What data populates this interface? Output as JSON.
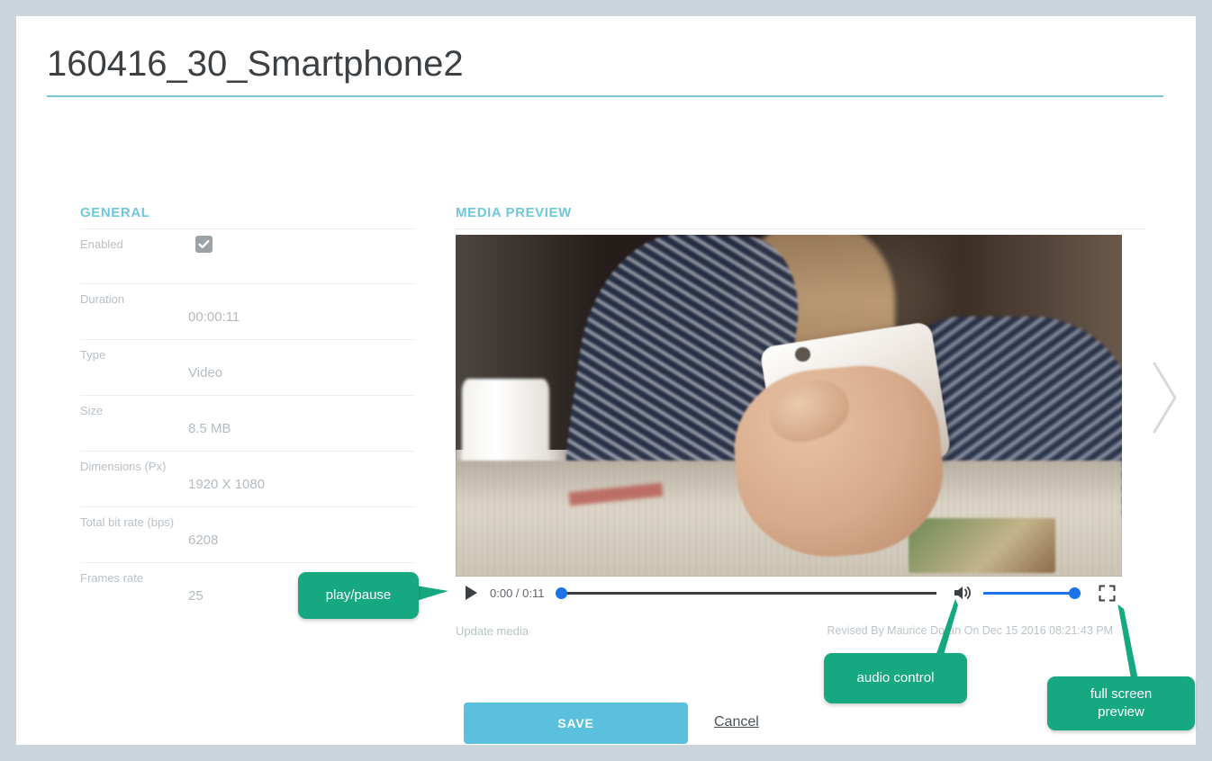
{
  "page": {
    "title": "160416_30_Smartphone2",
    "accent_underline": "#7cc4d0",
    "background": "#ccd4dc",
    "card_background": "#ffffff"
  },
  "general": {
    "heading": "GENERAL",
    "heading_color": "#6fc7dc",
    "fields": [
      {
        "label": "Enabled",
        "value": "",
        "type": "checkbox",
        "checked": true
      },
      {
        "label": "Duration",
        "value": "00:00:11",
        "type": "text"
      },
      {
        "label": "Type",
        "value": "Video",
        "type": "text"
      },
      {
        "label": "Size",
        "value": "8.5 MB",
        "type": "text"
      },
      {
        "label": "Dimensions (Px)",
        "value": "1920 X 1080",
        "type": "text"
      },
      {
        "label": "Total bit rate (bps)",
        "value": "6208",
        "type": "text"
      },
      {
        "label": "Frames rate",
        "value": "25",
        "type": "text"
      }
    ]
  },
  "media_preview": {
    "heading": "MEDIA PREVIEW",
    "player": {
      "play_icon": "play-icon",
      "time_display": "0:00 / 0:11",
      "current_time": "0:00",
      "duration": "0:11",
      "progress_percent": 0,
      "volume_percent": 100,
      "mute_icon": "speaker-volume-icon",
      "fullscreen_icon": "fullscreen-icon",
      "accent": "#1a73e8"
    },
    "update_link": "Update media",
    "revised_text": "Revised By Maurice Doran On Dec 15 2016 08:21:43 PM"
  },
  "footer": {
    "save_label": "SAVE",
    "save_color": "#5bc0de",
    "cancel_label": "Cancel"
  },
  "navigation": {
    "next_icon": "chevron-right-icon"
  },
  "callouts": {
    "color": "#16a981",
    "play": "play/pause",
    "audio": "audio control",
    "fullscreen_line1": "full screen",
    "fullscreen_line2": "preview"
  }
}
